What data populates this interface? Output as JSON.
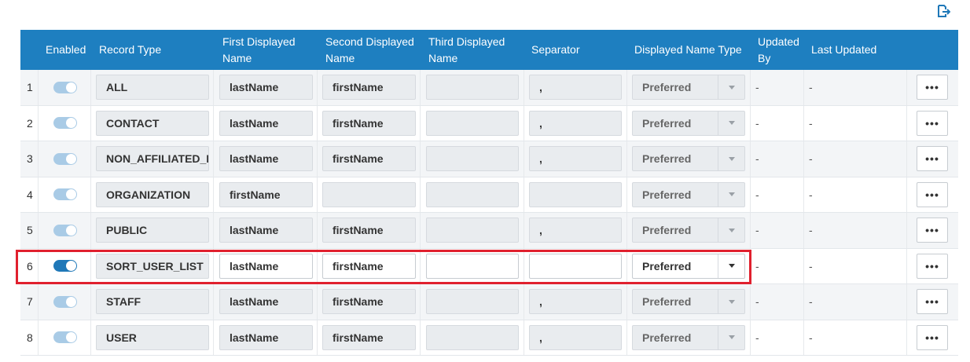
{
  "toolbar": {
    "export_icon": "export-icon"
  },
  "table": {
    "headers": {
      "enabled": "Enabled",
      "record_type": "Record Type",
      "first_name": "First Displayed Name",
      "second_name": "Second Displayed Name",
      "third_name": "Third Displayed Name",
      "separator": "Separator",
      "name_type": "Displayed Name Type",
      "updated_by": "Updated By",
      "last_updated": "Last Updated"
    },
    "rows": [
      {
        "index": "1",
        "enabled": true,
        "record_type": "ALL",
        "first": "lastName",
        "second": "firstName",
        "third": "",
        "separator": ",",
        "name_type": "Preferred",
        "updated_by": "-",
        "last_updated": "-",
        "more": "•••"
      },
      {
        "index": "2",
        "enabled": true,
        "record_type": "CONTACT",
        "first": "lastName",
        "second": "firstName",
        "third": "",
        "separator": ",",
        "name_type": "Preferred",
        "updated_by": "-",
        "last_updated": "-",
        "more": "•••"
      },
      {
        "index": "3",
        "enabled": true,
        "record_type": "NON_AFFILIATED_F",
        "first": "lastName",
        "second": "firstName",
        "third": "",
        "separator": ",",
        "name_type": "Preferred",
        "updated_by": "-",
        "last_updated": "-",
        "more": "•••"
      },
      {
        "index": "4",
        "enabled": true,
        "record_type": "ORGANIZATION",
        "first": "firstName",
        "second": "",
        "third": "",
        "separator": "",
        "name_type": "Preferred",
        "updated_by": "-",
        "last_updated": "-",
        "more": "•••"
      },
      {
        "index": "5",
        "enabled": true,
        "record_type": "PUBLIC",
        "first": "lastName",
        "second": "firstName",
        "third": "",
        "separator": ",",
        "name_type": "Preferred",
        "updated_by": "-",
        "last_updated": "-",
        "more": "•••"
      },
      {
        "index": "6",
        "enabled": true,
        "record_type": "SORT_USER_LIST",
        "first": "lastName",
        "second": "firstName",
        "third": "",
        "separator": "",
        "name_type": "Preferred",
        "updated_by": "-",
        "last_updated": "-",
        "more": "•••"
      },
      {
        "index": "7",
        "enabled": true,
        "record_type": "STAFF",
        "first": "lastName",
        "second": "firstName",
        "third": "",
        "separator": ",",
        "name_type": "Preferred",
        "updated_by": "-",
        "last_updated": "-",
        "more": "•••"
      },
      {
        "index": "8",
        "enabled": true,
        "record_type": "USER",
        "first": "lastName",
        "second": "firstName",
        "third": "",
        "separator": ",",
        "name_type": "Preferred",
        "updated_by": "-",
        "last_updated": "-",
        "more": "•••"
      }
    ]
  },
  "colors": {
    "header_bg": "#1e7fc0",
    "toggle_on": "#1f78b8",
    "toggle_disabled": "#a9cbe6",
    "highlight_border": "#e0202e"
  }
}
